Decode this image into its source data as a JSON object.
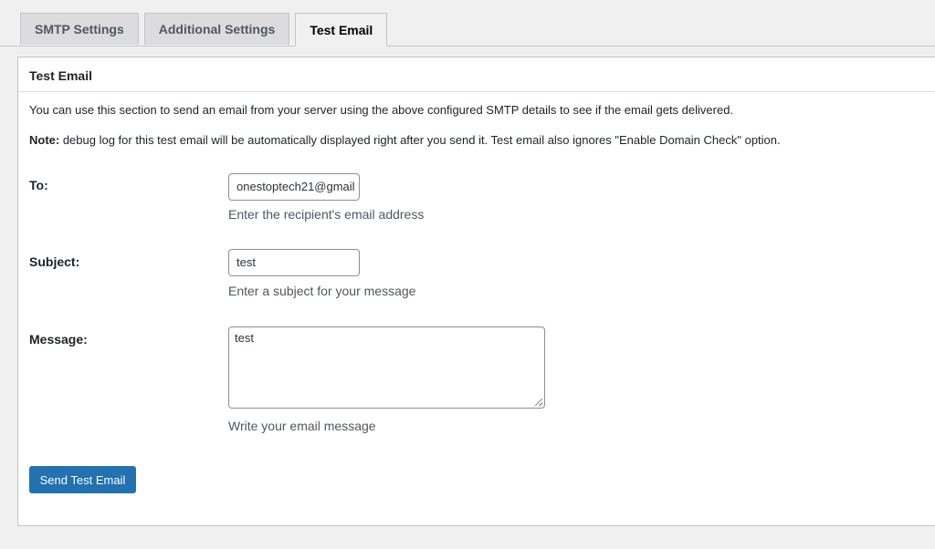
{
  "tabs": [
    {
      "label": "SMTP Settings",
      "active": false
    },
    {
      "label": "Additional Settings",
      "active": false
    },
    {
      "label": "Test Email",
      "active": true
    }
  ],
  "panel": {
    "title": "Test Email",
    "description": "You can use this section to send an email from your server using the above configured SMTP details to see if the email gets delivered.",
    "note_label": "Note:",
    "note_text": " debug log for this test email will be automatically displayed right after you send it. Test email also ignores \"Enable Domain Check\" option."
  },
  "form": {
    "to": {
      "label": "To:",
      "value": "onestoptech21@gmail",
      "hint": "Enter the recipient's email address"
    },
    "subject": {
      "label": "Subject:",
      "value": "test",
      "hint": "Enter a subject for your message"
    },
    "message": {
      "label": "Message:",
      "value": "test",
      "hint": "Write your email message"
    },
    "submit_label": "Send Test Email"
  },
  "colors": {
    "primary_button": "#2271b1",
    "background": "#f0f0f1",
    "panel": "#ffffff"
  }
}
